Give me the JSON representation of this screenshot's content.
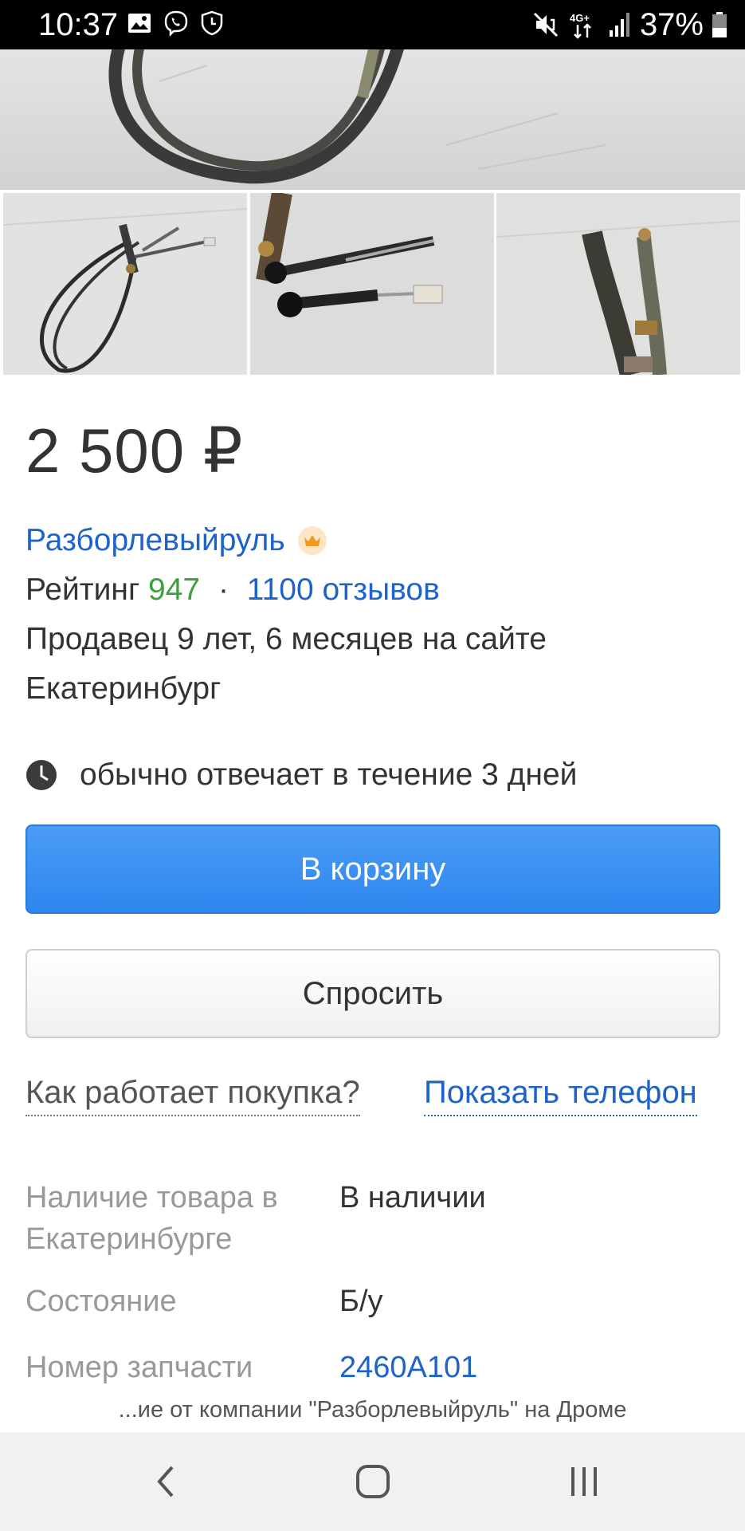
{
  "status_bar": {
    "time": "10:37",
    "battery": "37%",
    "network": "4G+",
    "icons": [
      "image-icon",
      "viber-icon",
      "shield-icon",
      "mute-icon",
      "signal-icon",
      "battery-icon"
    ]
  },
  "gallery": {
    "thumbnails": [
      "cable-photo-1",
      "cable-photo-2",
      "cable-photo-3"
    ]
  },
  "product": {
    "price": "2 500 ₽"
  },
  "seller": {
    "name": "Разборлевыйруль",
    "badge_icon": "crown-icon",
    "rating_label": "Рейтинг",
    "rating_value": "947",
    "separator": "·",
    "reviews": "1100 отзывов",
    "years": "Продавец 9 лет, 6 месяцев на сайте",
    "city": "Екатеринбург",
    "reply_time": "обычно отвечает в течение 3 дней"
  },
  "actions": {
    "cart_label": "В корзину",
    "ask_label": "Спросить",
    "how_label": "Как работает покупка?",
    "phone_label": "Показать телефон"
  },
  "specs": [
    {
      "label_line1": "Наличие товара в",
      "label_line2": "Екатеринбурге",
      "value": "В наличии"
    },
    {
      "label": "Состояние",
      "value": "Б/у"
    },
    {
      "label": "Номер запчасти",
      "value": "2460A101"
    }
  ],
  "footer_note": "...ие от компании \"Разборлевыйруль\" на Дроме",
  "colors": {
    "accent_blue": "#1e63c9",
    "button_blue": "#2d86ef",
    "rating_green": "#3aa23a",
    "muted_label": "#999999"
  },
  "navigation": {
    "back": "back-icon",
    "home": "home-icon",
    "recents": "recents-icon"
  }
}
